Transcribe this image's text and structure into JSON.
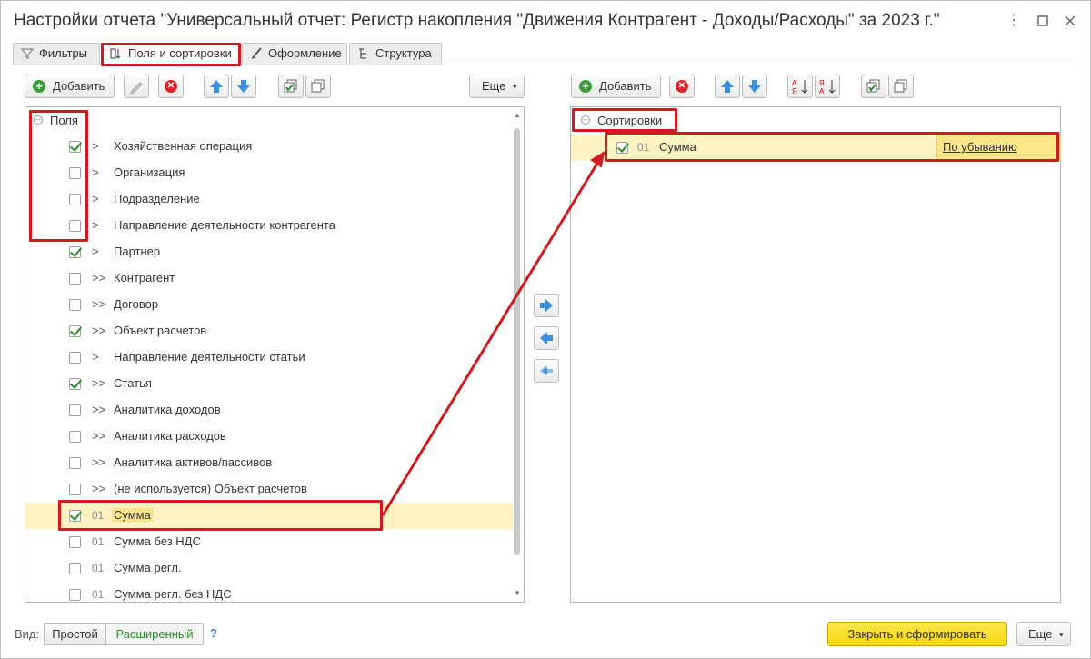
{
  "window": {
    "title": "Настройки отчета \"Универсальный отчет: Регистр накопления \"Движения Контрагент - Доходы/Расходы\" за 2023 г.\"",
    "menu_icon": "kebab-icon",
    "maximize_icon": "square-icon",
    "close_icon": "x-icon"
  },
  "tabs": [
    {
      "label": "Фильтры",
      "icon": "filter-icon"
    },
    {
      "label": "Поля и сортировки",
      "icon": "fields-sort-icon"
    },
    {
      "label": "Оформление",
      "icon": "brush-icon"
    },
    {
      "label": "Структура",
      "icon": "structure-icon"
    }
  ],
  "left_toolbar": {
    "add_label": "Добавить",
    "more_label": "Еще"
  },
  "right_toolbar": {
    "add_label": "Добавить"
  },
  "fields": {
    "root_label": "Поля",
    "items": [
      {
        "label": "Хозяйственная операция",
        "checked": true,
        "expander": ">",
        "number": ""
      },
      {
        "label": "Организация",
        "checked": false,
        "expander": ">",
        "number": ""
      },
      {
        "label": "Подразделение",
        "checked": false,
        "expander": ">",
        "number": ""
      },
      {
        "label": "Направление деятельности контрагента",
        "checked": false,
        "expander": ">",
        "number": ""
      },
      {
        "label": "Партнер",
        "checked": true,
        "expander": ">",
        "number": ""
      },
      {
        "label": "Контрагент",
        "checked": false,
        "expander": ">>",
        "number": ""
      },
      {
        "label": "Договор",
        "checked": false,
        "expander": ">>",
        "number": ""
      },
      {
        "label": "Объект расчетов",
        "checked": true,
        "expander": ">>",
        "number": ""
      },
      {
        "label": "Направление деятельности статьи",
        "checked": false,
        "expander": ">",
        "number": ""
      },
      {
        "label": "Статья",
        "checked": true,
        "expander": ">>",
        "number": ""
      },
      {
        "label": "Аналитика доходов",
        "checked": false,
        "expander": ">>",
        "number": ""
      },
      {
        "label": "Аналитика расходов",
        "checked": false,
        "expander": ">>",
        "number": ""
      },
      {
        "label": "Аналитика активов/пассивов",
        "checked": false,
        "expander": ">>",
        "number": ""
      },
      {
        "label": "(не используется) Объект расчетов",
        "checked": false,
        "expander": ">>",
        "number": ""
      },
      {
        "label": "Сумма",
        "checked": true,
        "expander": "",
        "number": "01"
      },
      {
        "label": "Сумма без НДС",
        "checked": false,
        "expander": "",
        "number": "01"
      },
      {
        "label": "Сумма регл.",
        "checked": false,
        "expander": "",
        "number": "01"
      },
      {
        "label": "Сумма регл. без НДС",
        "checked": false,
        "expander": "",
        "number": "01"
      }
    ]
  },
  "sortings": {
    "root_label": "Сортировки",
    "items": [
      {
        "number": "01",
        "label": "Сумма",
        "checked": true,
        "direction": "По убыванию"
      }
    ]
  },
  "footer": {
    "view_label": "Вид:",
    "simple_label": "Простой",
    "extended_label": "Расширенный",
    "help_label": "?",
    "submit_label": "Закрыть и сформировать",
    "more_label": "Еще"
  },
  "colors": {
    "highlight": "#fff3c4",
    "accent_yellow": "#ffe01b",
    "annotation_red": "#d11a1f",
    "extended_green": "#2a8a2a"
  }
}
